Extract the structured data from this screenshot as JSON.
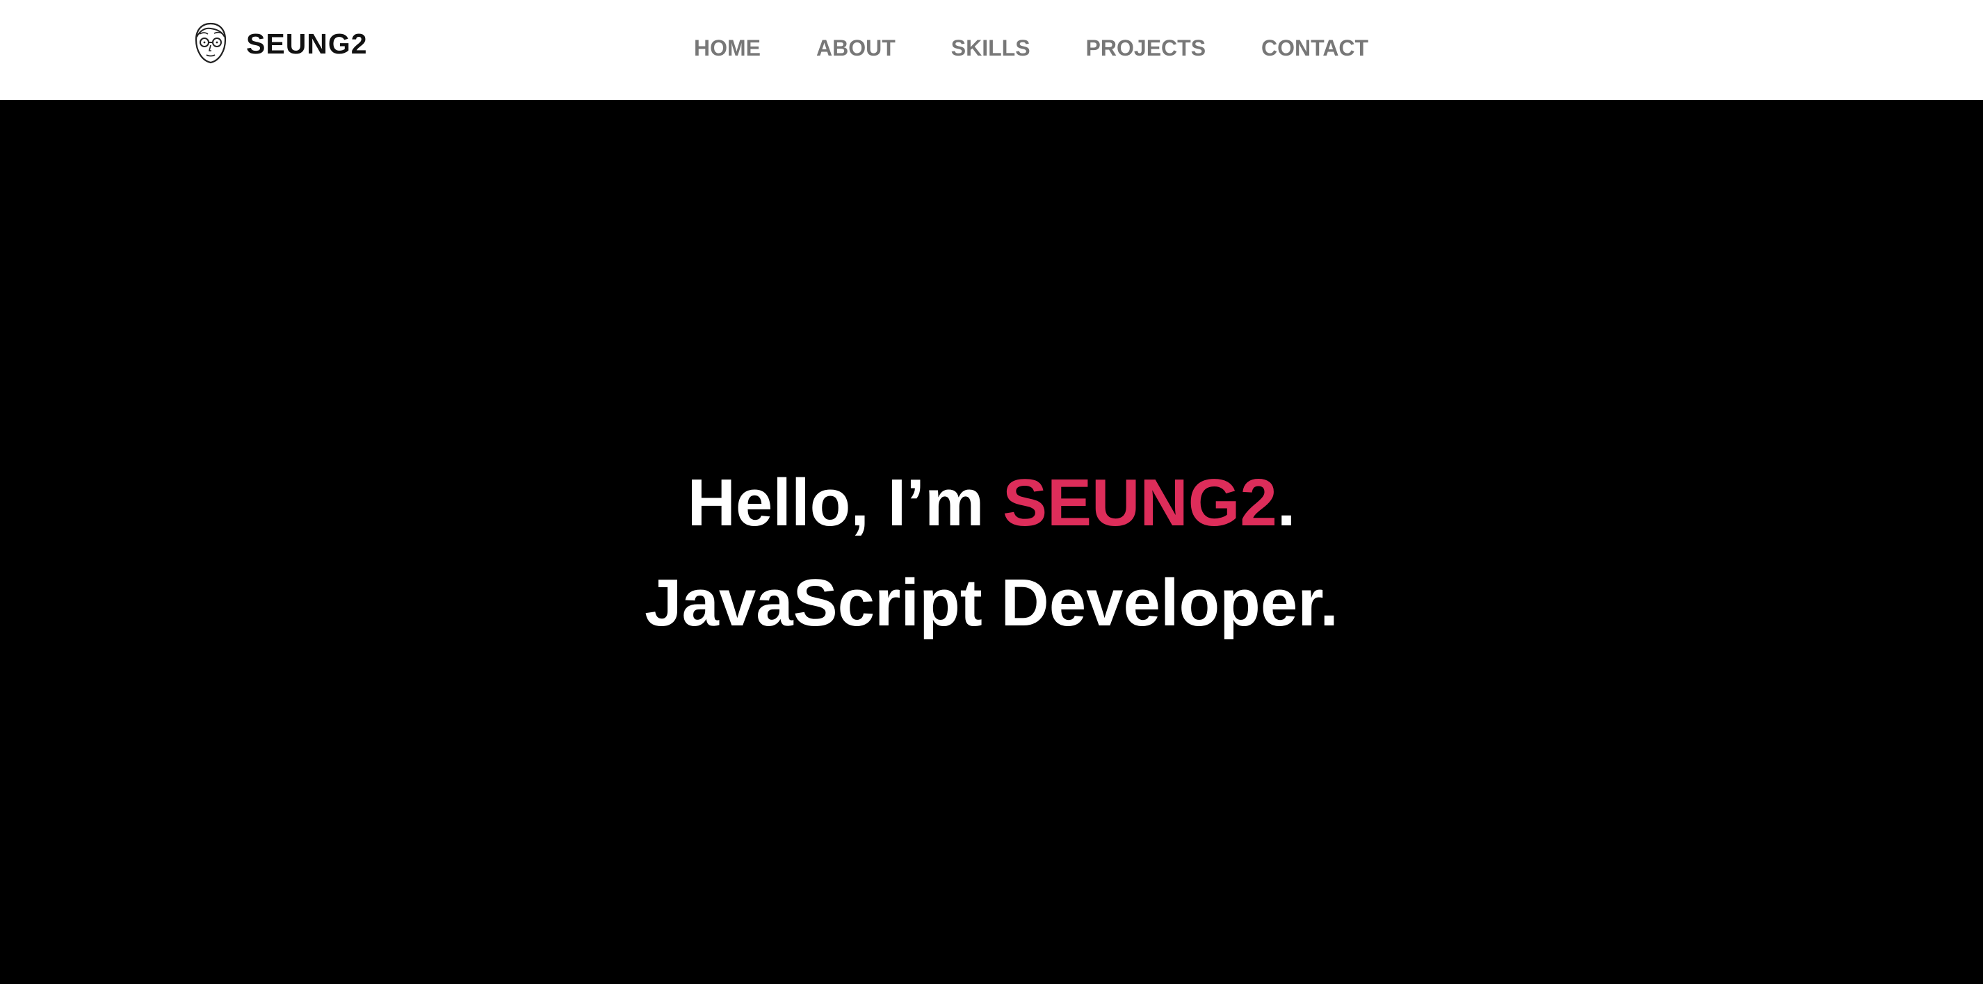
{
  "navbar": {
    "logo_icon": "face-with-glasses-icon",
    "logo_text": "SEUNG2",
    "menu": [
      {
        "label": "HOME"
      },
      {
        "label": "ABOUT"
      },
      {
        "label": "SKILLS"
      },
      {
        "label": "PROJECTS"
      },
      {
        "label": "CONTACT"
      }
    ]
  },
  "hero": {
    "greeting_prefix": "Hello, I’m ",
    "name": "SEUNG2",
    "greeting_suffix": ".",
    "role": "JavaScript Developer."
  },
  "colors": {
    "accent": "#dd2d5a",
    "nav_background": "#ffffff",
    "hero_background": "#000000",
    "menu_text": "#777777",
    "hero_text": "#ffffff"
  }
}
